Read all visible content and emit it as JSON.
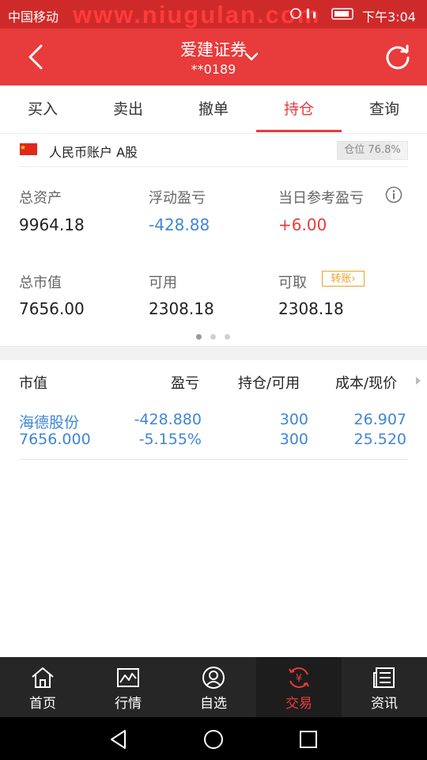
{
  "status_bar": {
    "carrier": "中国移动",
    "watermark": "www.niugulan.com",
    "time": "下午3:04"
  },
  "header": {
    "title": "爱建证券",
    "account_masked": "**0189"
  },
  "tabs": [
    {
      "label": "买入"
    },
    {
      "label": "卖出"
    },
    {
      "label": "撤单"
    },
    {
      "label": "持仓"
    },
    {
      "label": "查询"
    }
  ],
  "active_tab": "持仓",
  "account": {
    "currency_label": "人民币账户 A股",
    "position_ratio_label": "仓位 76.8%",
    "position_ratio": 0.768
  },
  "summary": {
    "total_assets": {
      "label": "总资产",
      "value": "9964.18"
    },
    "floating_pl": {
      "label": "浮动盈亏",
      "value": "-428.88"
    },
    "daily_ref_pl": {
      "label": "当日参考盈亏",
      "value": "+6.00"
    },
    "market_value": {
      "label": "总市值",
      "value": "7656.00"
    },
    "available": {
      "label": "可用",
      "value": "2308.18"
    },
    "withdrawable": {
      "label": "可取",
      "value": "2308.18"
    },
    "transfer_label": "转账"
  },
  "pager": {
    "pages": 3,
    "active": 0
  },
  "holdings": {
    "headers": {
      "market_value": "市值",
      "pl": "盈亏",
      "position": "持仓/可用",
      "cost_price": "成本/现价"
    },
    "rows": [
      {
        "name": "海德股份",
        "market_value": "7656.000",
        "pl": "-428.880",
        "pl_pct": "-5.155%",
        "position": "300",
        "available": "300",
        "cost": "26.907",
        "price": "25.520"
      }
    ]
  },
  "bottom_nav": [
    {
      "label": "首页",
      "icon": "home-icon"
    },
    {
      "label": "行情",
      "icon": "chart-icon"
    },
    {
      "label": "自选",
      "icon": "user-icon"
    },
    {
      "label": "交易",
      "icon": "yuan-exchange-icon"
    },
    {
      "label": "资讯",
      "icon": "news-icon"
    }
  ],
  "colors": {
    "brand_red": "#e83b3b",
    "loss_blue": "#3f86d6",
    "transfer_orange": "#e4a52a"
  }
}
